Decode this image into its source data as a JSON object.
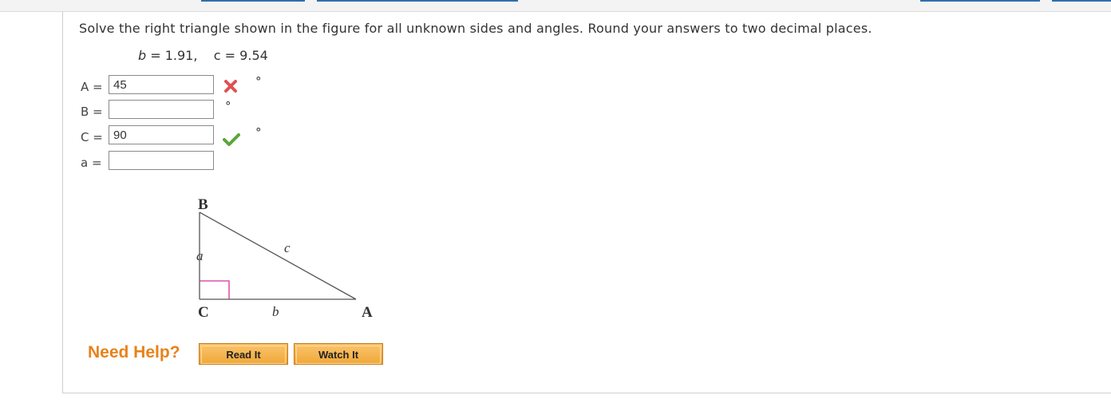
{
  "question": {
    "text": "Solve the right triangle shown in the figure for all unknown sides and angles. Round your answers to two decimal places.",
    "given_b_var": "b",
    "given_b_val": " = 1.91,",
    "given_c_var": "c",
    "given_c_val": " = 9.54"
  },
  "answers": [
    {
      "label": "A =",
      "value": "45",
      "unit": "°",
      "status": "incorrect"
    },
    {
      "label": "B =",
      "value": "",
      "unit": "°",
      "status": "none"
    },
    {
      "label": "C =",
      "value": "90",
      "unit": "°",
      "status": "correct"
    },
    {
      "label": "a =",
      "value": "",
      "unit": "",
      "status": "none"
    }
  ],
  "figure": {
    "vertex_B": "B",
    "vertex_C": "C",
    "vertex_A": "A",
    "side_a": "a",
    "side_b": "b",
    "side_c": "c"
  },
  "help": {
    "title": "Need Help?",
    "read_it": "Read It",
    "watch_it": "Watch It"
  },
  "colors": {
    "incorrect": "#e05050",
    "correct": "#5aa63a",
    "help_text": "#e8821a",
    "right_angle_mark": "#d0309a"
  }
}
